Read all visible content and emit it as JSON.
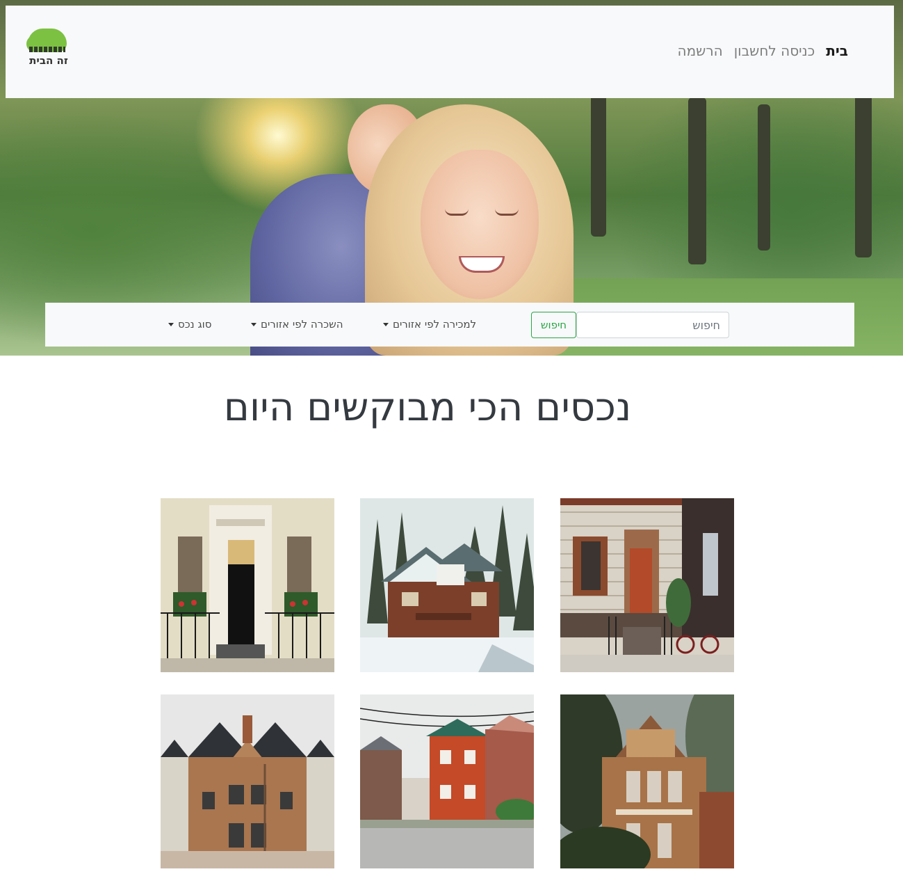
{
  "brand": {
    "logo_text": "זה הבית"
  },
  "nav": {
    "items": [
      {
        "label": "בית",
        "active": true
      },
      {
        "label": "כניסה לחשבון",
        "active": false
      },
      {
        "label": "הרשמה",
        "active": false
      }
    ]
  },
  "search": {
    "placeholder": "חיפוש",
    "value": "",
    "button_label": "חיפוש",
    "dropdowns": [
      {
        "label": "למכירה לפי אזורים"
      },
      {
        "label": "השכרה לפי אזורים"
      },
      {
        "label": "סוג נכס"
      }
    ]
  },
  "main": {
    "heading": "נכסים הכי מבוקשים היום"
  },
  "colors": {
    "brand_green": "#7cc142",
    "button_green": "#28a745",
    "navbar_bg": "#f8f9fa",
    "heading_text": "#343a40"
  }
}
